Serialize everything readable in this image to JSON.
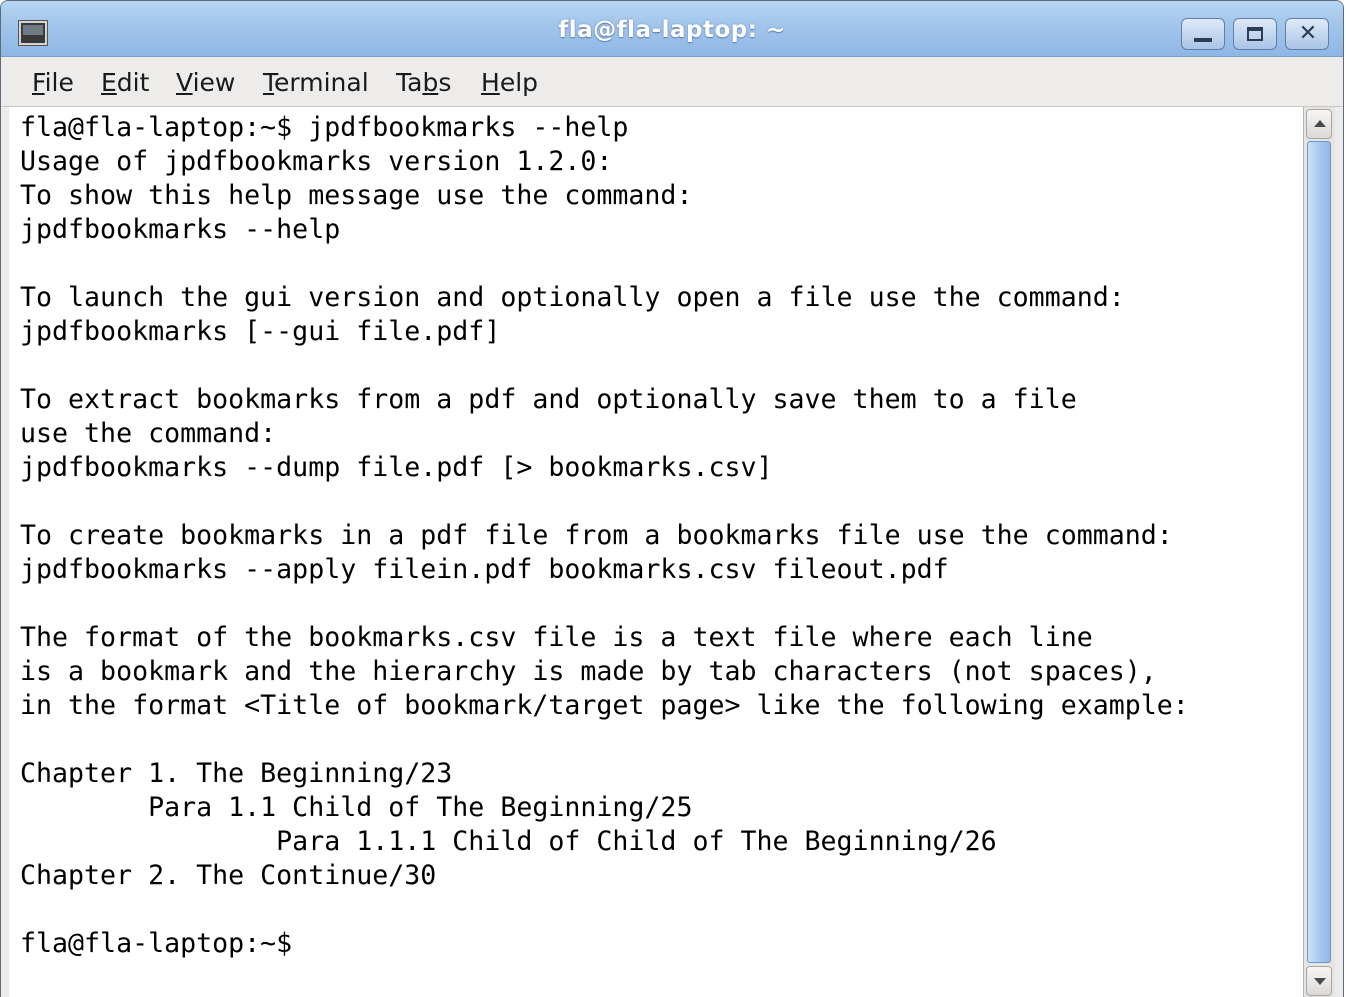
{
  "window": {
    "title": "fla@fla-laptop: ~"
  },
  "menubar": {
    "items": [
      {
        "pre": "",
        "mnemonic": "F",
        "post": "ile"
      },
      {
        "pre": "",
        "mnemonic": "E",
        "post": "dit"
      },
      {
        "pre": "",
        "mnemonic": "V",
        "post": "iew"
      },
      {
        "pre": "",
        "mnemonic": "T",
        "post": "erminal"
      },
      {
        "pre": "Ta",
        "mnemonic": "b",
        "post": "s"
      },
      {
        "pre": "",
        "mnemonic": "H",
        "post": "elp"
      }
    ]
  },
  "terminal": {
    "text": "fla@fla-laptop:~$ jpdfbookmarks --help\nUsage of jpdfbookmarks version 1.2.0:\nTo show this help message use the command:\njpdfbookmarks --help\n\nTo launch the gui version and optionally open a file use the command:\njpdfbookmarks [--gui file.pdf]\n\nTo extract bookmarks from a pdf and optionally save them to a file\nuse the command:\njpdfbookmarks --dump file.pdf [> bookmarks.csv]\n\nTo create bookmarks in a pdf file from a bookmarks file use the command:\njpdfbookmarks --apply filein.pdf bookmarks.csv fileout.pdf\n\nThe format of the bookmarks.csv file is a text file where each line\nis a bookmark and the hierarchy is made by tab characters (not spaces),\nin the format <Title of bookmark/target page> like the following example:\n\nChapter 1. The Beginning/23\n        Para 1.1 Child of The Beginning/25\n                Para 1.1.1 Child of Child of The Beginning/26\nChapter 2. The Continue/30\n\nfla@fla-laptop:~$"
  }
}
